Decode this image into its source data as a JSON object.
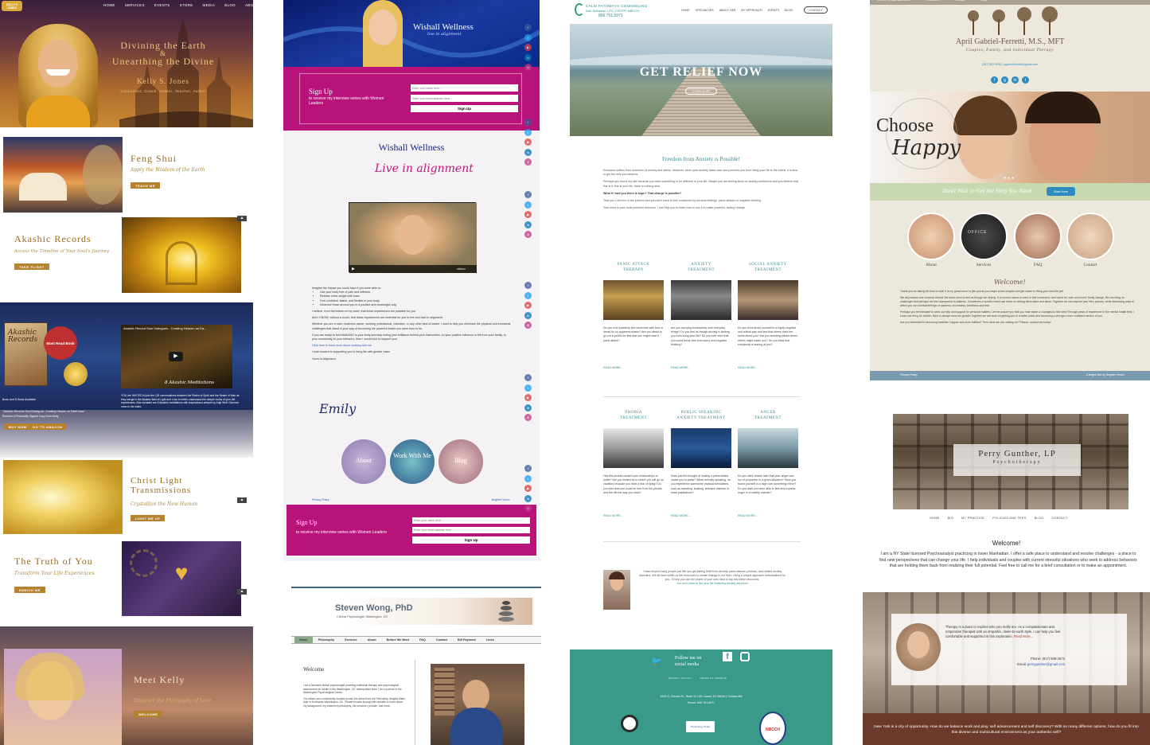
{
  "kelly": {
    "logo": "KELLY S JONES",
    "nav": [
      "HOME",
      "SERVICES",
      "EVENTS",
      "STORE",
      "MEDIA",
      "BLOG",
      "ABOUT"
    ],
    "hero_line1": "Divining the Earth",
    "hero_amp": "&",
    "hero_line2": "Unearthing the Divine",
    "hero_name": "Kelly S. Jones",
    "hero_sub": "Consultant, Coach, Healer, Teacher, Author",
    "feng_title": "Feng Shui",
    "feng_sub": "Apply the Wisdom of the Earth",
    "feng_btn": "TEACH ME",
    "akashic_title": "Akashic Records",
    "akashic_sub": "Access the Timeline of Your Soul's Journey",
    "akashic_btn": "TAKE FLIGHT",
    "book_title": "Akashic Records",
    "book_badge": "Most Read Book",
    "video_title": "Akashic Record Soul Dialogues - Creating Heaven on Ea...",
    "video_caption": "8 Akashic Meditations",
    "book_text1": "Book and E-Book Available",
    "book_text2": "\"Akashic Records Soul Dialogues: Creating Heaven on Earth Now\"",
    "book_text3": "Receive a Personally Signed Copy from Kelly",
    "invite_text": "YOU are INVITED to join the 118 conversations between the Realm of Spirit and the Realm of Man as they merge in the Akashic field of Light and Love to better understand the deeper truths of your life experiences. Also included are 8 Akashic meditations with inspirational artwork by Adja Wolf. Discover more in the video.",
    "buy_btn": "BUY NOW",
    "amazon_btn": "GO TO AMAZON",
    "christ_title1": "Christ Light",
    "christ_title2": "Transmissions",
    "christ_sub": "Crystallize the New Human",
    "christ_btn": "LIGHT ME UP",
    "truth_title": "The Truth of You",
    "truth_sub": "Transform Your Life Experiences",
    "truth_btn": "ENRICH ME",
    "meet_title": "Meet Kelly",
    "meet_sub": "Discover the Philosophy of Love",
    "meet_btn": "WELCOME"
  },
  "wishall": {
    "logo": "Wishall Wellness",
    "logo_sub": "live in alignment",
    "signup_title": "Sign Up",
    "signup_sub": "to receive my interview series with Women Leaders",
    "name_placeholder": "Enter your name here...",
    "email_placeholder": "Enter your email address here...",
    "signup_btn": "Sign Up",
    "title": "Wishall Wellness",
    "script": "Live in alignment",
    "video_label": "vimeo",
    "body_intro": "Imagine the impact you could have if you were able to:",
    "bullets": [
      "Use your body free of pain and stiffness",
      "Release extra weight with ease",
      "Feel confident, stable, and flexible in your body",
      "Influence those around you in a positive and meaningful way"
    ],
    "p1": "I believe, from the bottom of my heart, that these experiences are possible for you.",
    "p2": "And I KNOW, without a doubt, that these experiences are essential for you to live and lead in alignment.",
    "p3": "Whether you are a mom, business owner, working professional, volunteer, or any other kind of leader, I want to help you eliminate the physical and emotional challenges that stand in your way of becoming the powerful leader you were born to be.",
    "p4": "If you are ready to feel AMAZING in your body and stop hiding your brilliance behind your insecurities, so your positive influence is felt from your family, to your community, to your followers, then I would love to support you!",
    "link": "Click here to learn more about working with me.",
    "p5": "I look forward to supporting you to living life with greater ease.",
    "p6": "Yours in Alignment,",
    "signature": "Emily",
    "circles": [
      "About",
      "Work With Me",
      "Blog"
    ],
    "footer_left": "Privacy Policy",
    "footer_right": "Brighter Vision"
  },
  "steven": {
    "name": "Steven Wong, PhD",
    "sub": "Clinical Psychologist, Washington, DC",
    "nav": [
      "Home",
      "Philosophy",
      "Services",
      "About",
      "Before We Meet",
      "FAQ",
      "Contact",
      "Bill Payment",
      "Links"
    ],
    "welcome": "Welcome",
    "p1": "I am a licensed clinical psychologist providing individual therapy and psychological assessment for adults in the Washington, DC metropolitan area. I am a partner in the Washington Psychological Center.",
    "p2": "Our offices are conveniently located across the street from the Friendship Heights Metro stop in Northwest Washington, DC. Please browse through this website to learn about my background, my treatment philosophy, the services I provide, and more."
  },
  "calm": {
    "logo_name": "CALM PATHWAYS COUNSELING",
    "logo_sub": "Deb Schwartz, LPC, CSOTP, NBCCH",
    "phone": "856.751.5971",
    "nav": [
      "HOME",
      "SPECIALTIES",
      "ABOUT DEB",
      "MY APPROACH",
      "EVENTS",
      "BLOG"
    ],
    "contact_btn": "CONTACT",
    "hero_title": "GET RELIEF NOW",
    "hero_btn": "LEARN MORE",
    "heading": "Freedom from Anxiety is Possible!",
    "p1": "Everyone suffers from moments of anxiety and stress. However, when your anxiety takes over and prevents you from living your life to the fullest, it is time to get the help you deserve.",
    "p2": "Perhaps you found my site because you want something to be different in your life. Maybe you are feeling stuck or lacking confidence and you believe that this is it, this is your life, there is nothing else.",
    "p3": "What if I told you there is hope? That change is possible?",
    "p4": "That you CAN live in the present and you don't have to feel consumed by anxious feelings, panic attacks or negative thinking.",
    "p5": "Your mind is your most powerful resource. I can help you to learn how to use it to make powerful, lasting change.",
    "cards1": [
      {
        "t1": "PANIC ATTACK",
        "t2": "THERAPY",
        "body": "Do you ever suddenly feel overcome with fear or dread for no apparent reason? Are you afraid to go out in public for fear that you might have a panic attack?"
      },
      {
        "t1": "ANXIETY",
        "t2": "TREATMENT",
        "body": "Are you worrying excessively over everyday things? Do you feel as though anxiety is limiting you from living your life? Do you ever wish that you could break free from worry and negative thinking?"
      },
      {
        "t1": "SOCIAL ANXIETY",
        "t2": "TREATMENT",
        "body": "Do you think about yourself in a highly negative and critical way and feel that others think the same about you? Are you avoiding places where others might watch you? Do you think that everybody is staring at you?"
      }
    ],
    "cards2": [
      {
        "t1": "PHOBIA",
        "t2": "TREATMENT",
        "body": "Has this phobia caused your relationships to suffer? Are you limited as to where you will go on vacation because you have a fear of flying? Do you wish that you could be free from the phobia and live life the way you want?"
      },
      {
        "t1": "PUBLIC SPEAKING",
        "t2": "ANXIETY TREATMENT",
        "body": "Does just the thought of making a presentation cause you to panic? When actually speaking, do you experience worrisome physical sensations, such as sweating, shaking, stomach distress or heart palpitations?"
      },
      {
        "t1": "ANGER",
        "t2": "TREATMENT",
        "body": "Do you often realize later that your anger was out of proportion to a given situation? Have you found yourself in a rage over something minor? Do you wish you were able to feel and express anger in a healthy manner?"
      }
    ],
    "read_more": "READ MORE...",
    "bio": "I have helped many people just like you get lasting relief from anxiety, panic attacks, phobias, and related anxiety disorders. We all have within us the resources to create change in our lives. Using a unique approach individualized for you, I'll help you use the power of your own mind to tap into these resources.",
    "bio_link": "You don't have to live your life limited by anxiety anymore!",
    "follow": "Follow me on",
    "follow2": "social media",
    "footer_links": [
      "PRIVACY POLICY",
      "TERMS OF SERVICE"
    ],
    "address": "1200 S. Church St., Suite 12 | Mt. Laurel, NJ 08054 | Contact Me",
    "footer_phone": "Phone: 856.751.5971",
    "badge_nbcch": "NBCCH",
    "badge_pt": "Psychology Today"
  },
  "april": {
    "nav": [
      "Events, Groups and More!",
      "Resources",
      "Contact",
      "Blog"
    ],
    "name": "April Gabriel-Ferretti, M.S., MFT",
    "sub": "Couples, Family, and Individual Therapy",
    "contact": "(267) 987-4035 | agabrielferretti@gmail.com",
    "hero1": "Choose",
    "hero2": "Happy",
    "band_text": "Don't Wait to Get the Help You Need",
    "band_btn": "Start Here",
    "circles": [
      "About",
      "Services",
      "FAQ",
      "Contact"
    ],
    "office_sign": "OFFICE",
    "welcome": "Welcome!",
    "p1": "Thank you for taking the time to visit! It is my great honor to join you as you begin a new chapter and get closer to living your best life yet!",
    "p2": "We all possess one common thread: the basic need to feel as though we belong. It is human nature to want to feel connected, well cared for, safe and loved. Sadly, though, life can bring us challenges that perhaps we feel unprepared to address. Sometimes a specific event can leave us feeling blind-sided and alone. Together we can explore your life's journey, while discussing ways in which you can combat feelings of sadness, uncertainty, loneliness and fear.",
    "p3": "Perhaps you feel hesitant to seek out help and support for personal matters. Let me assure you that you have taken a courageous first step! Through years of experience in the mental health field, I know one thing for certain: there is always room for growth! Together we will work on getting you to a better place and becoming a stronger, more confident version of you.",
    "p4": "Are you interested in becoming healthier, happier and more fulfilled? Then what are you waiting for? Please, contact me today!",
    "footer_left": "Privacy Policy",
    "footer_right": "A Bright Site by Brighter Vision"
  },
  "perry": {
    "name": "Perry Gunther, LP",
    "sub": "Psychotherapy",
    "nav": [
      "HOME",
      "BIO",
      "MY PRACTICE",
      "POLICIES AND FEES",
      "BLOG",
      "CONTACT"
    ],
    "welcome": "Welcome!",
    "p1": "I am a NY State licensed Psychoanalyst practicing in lower Manhattan. I offer a safe place to understand and resolve challenges - a place to find new perspectives that can change your life. I help individuals and couples with current stressful situations who seek to address behaviors that are holding them back from realizing their full potential. Feel free to call me for a brief consultation or to make an appointment.",
    "card_text": "Therapy is a place to explore who you really are. As a compassionate and responsive therapist with an empathic, down-to-earth style, I can help you feel comfortable and supported in this exploration.",
    "read_more": "Read More...",
    "phone": "Phone: (917) 608-2673",
    "email_label": "Email: ",
    "email": "perrygunther@gmail.com",
    "bottom": "New York is a city of opportunity. How do we balance work and play, self advancement and self discovery? With so many different options, how do you fit into this diverse and multicultural environment as your authentic self?"
  },
  "colors": {
    "gold": "#b5832f",
    "magenta": "#b8137a",
    "teal": "#3a9a8a",
    "calm_heading": "#2f8a8a",
    "april_blue": "#2e8bc0",
    "perry_bottom": "#6b3a2a"
  }
}
